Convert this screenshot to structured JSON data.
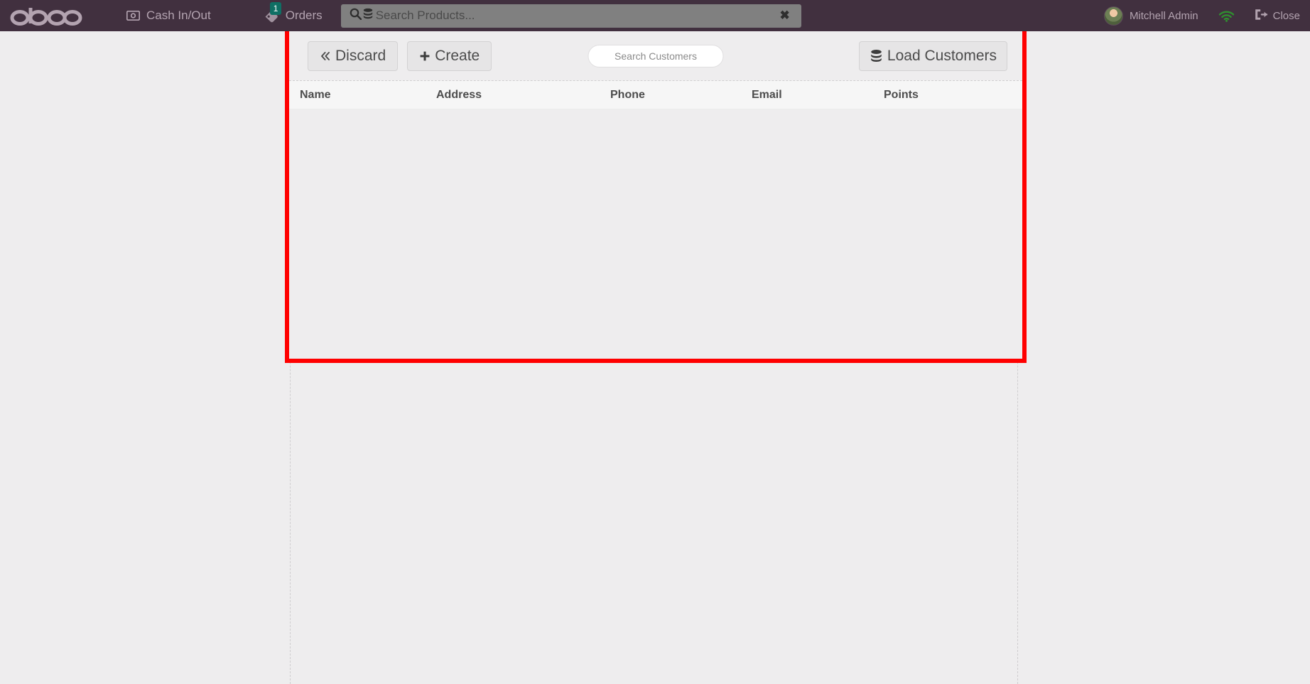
{
  "topbar": {
    "logo_text": "odoo",
    "cash_in_out": {
      "label": "Cash In/Out",
      "icon": "money-bill-icon"
    },
    "orders": {
      "label": "Orders",
      "icon": "ticket-icon",
      "badge": "1"
    },
    "search": {
      "placeholder": "Search Products...",
      "value": "",
      "search_icon": "search-icon",
      "stack_icon": "database-stack-icon",
      "clear_label": "✖"
    },
    "user": {
      "name": "Mitchell Admin",
      "avatar": "user-avatar"
    },
    "wifi": {
      "icon": "wifi-icon",
      "color": "#2f8f2f"
    },
    "close": {
      "label": "Close",
      "icon": "sign-out-icon"
    }
  },
  "panel": {
    "discard": {
      "label": "Discard",
      "icon": "chevron-double-left-icon"
    },
    "create": {
      "label": "Create",
      "icon": "plus-icon"
    },
    "customer_search": {
      "placeholder": "Search Customers",
      "value": ""
    },
    "load_customers": {
      "label": "Load Customers",
      "icon": "database-stack-icon"
    },
    "table": {
      "columns": [
        "Name",
        "Address",
        "Phone",
        "Email",
        "Points"
      ],
      "rows": []
    }
  },
  "highlight": {
    "color": "#ff0000"
  }
}
